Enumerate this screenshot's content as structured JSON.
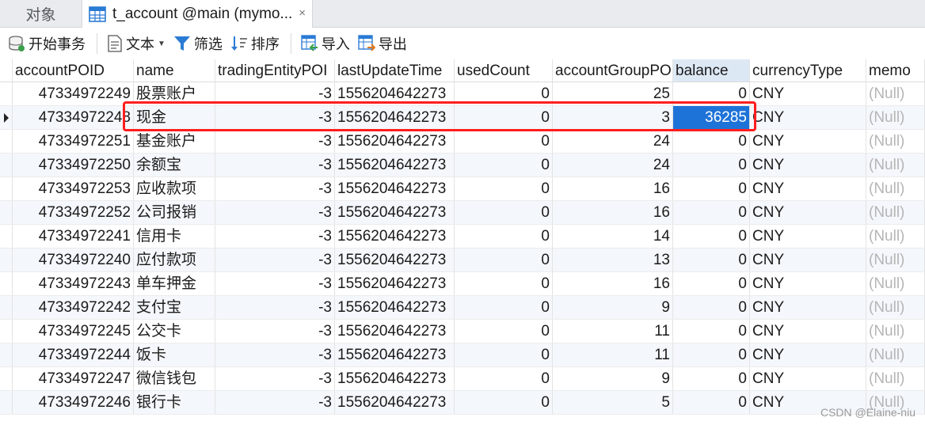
{
  "tabs": {
    "objects": "对象",
    "active": "t_account @main (mymo...",
    "close": "×"
  },
  "toolbar": {
    "begin_transaction": "开始事务",
    "text": "文本",
    "filter": "筛选",
    "sort": "排序",
    "import": "导入",
    "export": "导出"
  },
  "columns": [
    "accountPOID",
    "name",
    "tradingEntityPOI",
    "lastUpdateTime",
    "usedCount",
    "accountGroupPO",
    "balance",
    "currencyType",
    "memo"
  ],
  "rows": [
    [
      "47334972249",
      "股票账户",
      "-3",
      "1556204642273",
      "0",
      "25",
      "0",
      "CNY",
      "(Null)"
    ],
    [
      "47334972248",
      "现金",
      "-3",
      "1556204642273",
      "0",
      "3",
      "36285",
      "CNY",
      "(Null)"
    ],
    [
      "47334972251",
      "基金账户",
      "-3",
      "1556204642273",
      "0",
      "24",
      "0",
      "CNY",
      "(Null)"
    ],
    [
      "47334972250",
      "余额宝",
      "-3",
      "1556204642273",
      "0",
      "24",
      "0",
      "CNY",
      "(Null)"
    ],
    [
      "47334972253",
      "应收款项",
      "-3",
      "1556204642273",
      "0",
      "16",
      "0",
      "CNY",
      "(Null)"
    ],
    [
      "47334972252",
      "公司报销",
      "-3",
      "1556204642273",
      "0",
      "16",
      "0",
      "CNY",
      "(Null)"
    ],
    [
      "47334972241",
      "信用卡",
      "-3",
      "1556204642273",
      "0",
      "14",
      "0",
      "CNY",
      "(Null)"
    ],
    [
      "47334972240",
      "应付款项",
      "-3",
      "1556204642273",
      "0",
      "13",
      "0",
      "CNY",
      "(Null)"
    ],
    [
      "47334972243",
      "单车押金",
      "-3",
      "1556204642273",
      "0",
      "16",
      "0",
      "CNY",
      "(Null)"
    ],
    [
      "47334972242",
      "支付宝",
      "-3",
      "1556204642273",
      "0",
      "9",
      "0",
      "CNY",
      "(Null)"
    ],
    [
      "47334972245",
      "公交卡",
      "-3",
      "1556204642273",
      "0",
      "11",
      "0",
      "CNY",
      "(Null)"
    ],
    [
      "47334972244",
      "饭卡",
      "-3",
      "1556204642273",
      "0",
      "11",
      "0",
      "CNY",
      "(Null)"
    ],
    [
      "47334972247",
      "微信钱包",
      "-3",
      "1556204642273",
      "0",
      "9",
      "0",
      "CNY",
      "(Null)"
    ],
    [
      "47334972246",
      "银行卡",
      "-3",
      "1556204642273",
      "0",
      "5",
      "0",
      "CNY",
      "(Null)"
    ]
  ],
  "current_row": 1,
  "selected_column": 6,
  "watermark": "CSDN @Elaine-niu",
  "colors": {
    "selection": "#1e73d8",
    "highlight_box": "#ff1e1e",
    "filter_icon": "#2a7bd4"
  }
}
